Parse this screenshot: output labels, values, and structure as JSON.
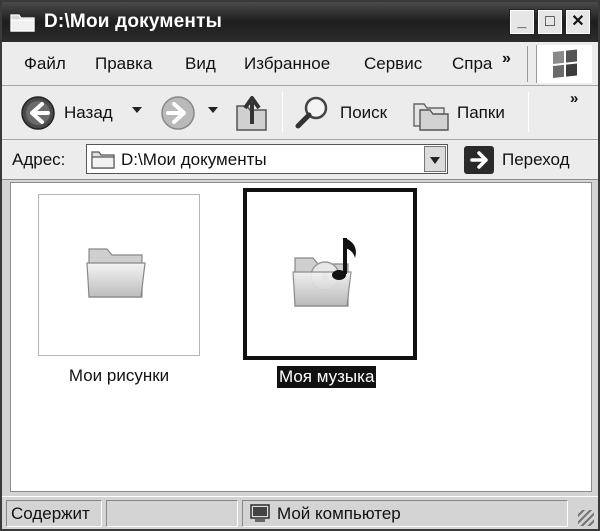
{
  "window": {
    "title": "D:\\Мои документы",
    "minimize": "_",
    "maximize": "□",
    "close": "✕"
  },
  "menu": {
    "items": [
      "Файл",
      "Правка",
      "Вид",
      "Избранное",
      "Сервис",
      "Спра"
    ],
    "overflow": "»"
  },
  "toolbar": {
    "back_label": "Назад",
    "search_label": "Поиск",
    "folders_label": "Папки",
    "overflow": "»"
  },
  "address": {
    "label": "Адрес:",
    "value": "D:\\Мои документы",
    "go_label": "Переход"
  },
  "items": [
    {
      "label": "Мои рисунки",
      "icon": "folder-icon",
      "selected": false
    },
    {
      "label": "Моя музыка",
      "icon": "music-folder-icon",
      "selected": true
    }
  ],
  "status": {
    "left": "Содержит",
    "middle": "",
    "zone": "Мой компьютер"
  }
}
